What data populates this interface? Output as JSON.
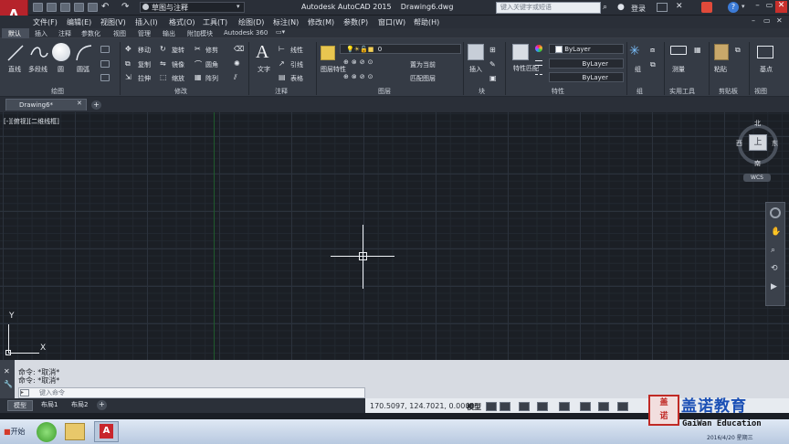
{
  "app": {
    "logo": "A",
    "title": "Autodesk AutoCAD 2015",
    "document": "Drawing6.dwg",
    "workspace": "草图与注释",
    "search_placeholder": "键入关键字或短语",
    "login": "登录"
  },
  "menu": [
    "文件(F)",
    "编辑(E)",
    "视图(V)",
    "插入(I)",
    "格式(O)",
    "工具(T)",
    "绘图(D)",
    "标注(N)",
    "修改(M)",
    "参数(P)",
    "窗口(W)",
    "帮助(H)"
  ],
  "ribbon_tabs": [
    "默认",
    "插入",
    "注释",
    "参数化",
    "视图",
    "管理",
    "输出",
    "附加模块",
    "Autodesk 360"
  ],
  "groups": {
    "draw": {
      "label": "绘图",
      "tools": [
        "直线",
        "多段线",
        "圆",
        "圆弧"
      ]
    },
    "modify": {
      "label": "修改",
      "tools": [
        "移动",
        "旋转",
        "修剪",
        "复制",
        "镜像",
        "圆角",
        "拉伸",
        "缩放",
        "阵列"
      ]
    },
    "annotation": {
      "label": "注释",
      "tools": [
        "文字",
        "线性",
        "引线",
        "表格"
      ]
    },
    "layers": {
      "label": "图层",
      "layer_value": "0",
      "tools": [
        "图层特性",
        "置为当前",
        "匹配图层"
      ]
    },
    "block": {
      "label": "块",
      "tools": [
        "插入"
      ]
    },
    "properties": {
      "label": "特性",
      "tools": [
        "特性匹配"
      ],
      "color": "ByLayer",
      "linetype": "ByLayer",
      "lineweight": "ByLayer"
    },
    "groups": {
      "label": "组",
      "tools": [
        "组"
      ]
    },
    "utilities": {
      "label": "实用工具",
      "tools": [
        "测量"
      ]
    },
    "clipboard": {
      "label": "剪贴板",
      "tools": [
        "粘贴"
      ]
    },
    "view": {
      "label": "视图",
      "tools": [
        "基点"
      ]
    }
  },
  "doc_tabs": [
    "Drawing6*"
  ],
  "viewport_label": "[-][俯视][二维线框]",
  "viewcube": {
    "north": "北",
    "south": "南",
    "east": "东",
    "west": "西",
    "top": "上",
    "wcs": "WCS"
  },
  "ucs": {
    "x": "X",
    "y": "Y"
  },
  "command": {
    "history": [
      "命令: *取消*",
      "命令: *取消*"
    ],
    "placeholder": "键入命令"
  },
  "layouts": [
    "模型",
    "布局1",
    "布局2"
  ],
  "status": {
    "coords": "170.5097, 124.7021, 0.0000",
    "model": "模型"
  },
  "taskbar": {
    "start": "开始",
    "clock_time": "星期三",
    "clock_date": "2016/4/20 星期三",
    "watermark": "盖诺教育",
    "watermark_en": "GaiWan Education"
  },
  "colors": {
    "accent": "#b6232b",
    "canvas": "#1b1f25",
    "ribbon": "#353b45"
  }
}
